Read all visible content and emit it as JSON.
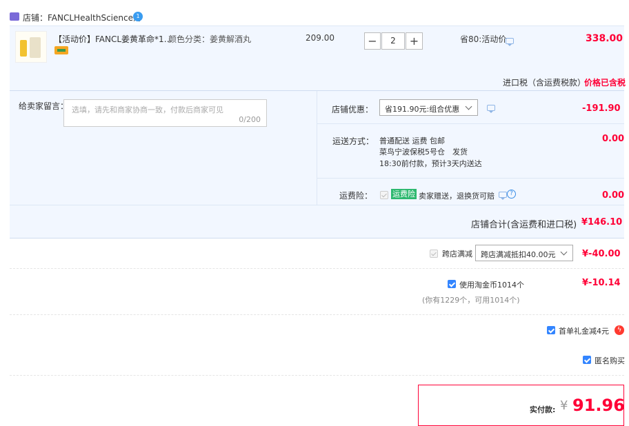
{
  "shop": {
    "label": "店铺：FANCLHealthScience海",
    "badge": "1"
  },
  "item": {
    "title": "【活动价】FANCL姜黄革命*1…",
    "sku_label": "颜色分类：姜黄解酒丸",
    "unit_price": "209.00",
    "quantity": "2",
    "minus": "−",
    "plus": "+",
    "discount": "省80:活动价",
    "total": "338.00"
  },
  "tax": {
    "label": "进口税（含运费税款）",
    "value": "价格已含税"
  },
  "message": {
    "label": "给卖家留言：",
    "placeholder": "选填，请先和商家协商一致，付款后商家可见",
    "counter": "0/200"
  },
  "shop_discount": {
    "label": "店铺优惠：",
    "selected": "省191.90元:组合优惠",
    "amount": "-191.90"
  },
  "shipping": {
    "label": "运送方式：",
    "line1": "普通配送 运费 包邮",
    "line2": "菜鸟宁波保税5号仓　发货",
    "line3": "18:30前付款，预计3天内送达",
    "amount": "0.00"
  },
  "insurance": {
    "label": "运费险：",
    "tag": "运费险",
    "text": "卖家赠送，退换货可赔",
    "help": "?",
    "amount": "0.00"
  },
  "shop_total": {
    "label": "店铺合计(含运费和进口税)",
    "value": "¥146.10"
  },
  "cross_store": {
    "label": "跨店满减",
    "selected": "跨店满减抵扣40.00元",
    "amount": "¥-40.00"
  },
  "coins": {
    "label": "使用淘金币1014个",
    "note": "(你有1229个，可用1014个)",
    "amount": "¥-10.14"
  },
  "gift": {
    "label": "首单礼金减4元",
    "icon": "ϟ"
  },
  "anonymous": {
    "label": "匿名购买"
  },
  "pay": {
    "label": "实付款:",
    "currency": "¥",
    "value": "91.96"
  },
  "colors": {
    "accent": "#ff0036",
    "blue": "#3385ff",
    "panel": "#f2f7ff"
  }
}
